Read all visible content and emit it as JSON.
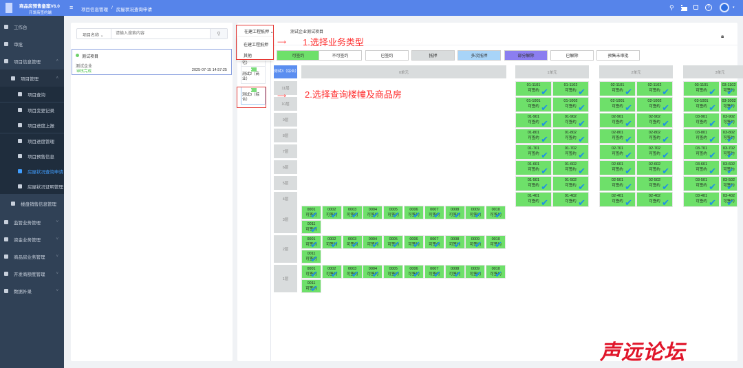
{
  "header": {
    "app_title": "商品房预售备案V6.0",
    "app_subtitle": "开发商签约端",
    "breadcrumb": [
      "项目信息管理",
      "房屋状况查询申请"
    ],
    "separator": "/"
  },
  "sidebar": {
    "items": [
      {
        "label": "工作台",
        "icon": "dashboard-icon"
      },
      {
        "label": "审批",
        "icon": "approval-icon"
      },
      {
        "label": "项目信息管理",
        "icon": "document-icon",
        "chev": "^"
      },
      {
        "label": "项目管理",
        "icon": "grid-icon",
        "chev": "^"
      },
      {
        "label": "项目查询",
        "icon": "search-icon"
      },
      {
        "label": "项目变更记录",
        "icon": "edit-icon"
      },
      {
        "label": "项目进度上报",
        "icon": "upload-icon"
      },
      {
        "label": "项目进度管理",
        "icon": "list-icon"
      },
      {
        "label": "项目预售信息",
        "icon": "table-icon"
      },
      {
        "label": "房屋状况查询申请",
        "icon": "house-icon",
        "active": true
      },
      {
        "label": "房屋状况证明管理",
        "icon": "grid-icon"
      },
      {
        "label": "楼盘销售信息管理",
        "icon": "grid-icon"
      },
      {
        "label": "监管业务管理",
        "icon": "document-icon",
        "chev": "v"
      },
      {
        "label": "资金业务管理",
        "icon": "document-icon",
        "chev": "v"
      },
      {
        "label": "商品房业务管理",
        "icon": "document-icon",
        "chev": "v"
      },
      {
        "label": "开发商额度管理",
        "icon": "document-icon",
        "chev": "v"
      },
      {
        "label": "数据补录",
        "icon": "document-icon",
        "chev": "v"
      }
    ]
  },
  "search": {
    "select": "项目名称",
    "placeholder": "请输入搜索内容"
  },
  "project": {
    "name": "测试项目",
    "company": "测试企业",
    "status": "审核完成",
    "time": "2025-07-15 14:57:25"
  },
  "business_type": {
    "selected": "在建工程抵押",
    "options": [
      "在建工程抵押",
      "其他"
    ],
    "project_title": "测试企业测试项目"
  },
  "buildings": [
    "测试1（住宅）",
    "测试2（商业）",
    "测试3（综合）"
  ],
  "legend": [
    {
      "label": "可签约",
      "bg": "#6ee06a"
    },
    {
      "label": "不可签约",
      "bg": "#fff",
      "corner": "#e020e0"
    },
    {
      "label": "已签约",
      "bg": "#fff",
      "corner": "#30d8b0"
    },
    {
      "label": "抵押",
      "bg": "#d9dcdd"
    },
    {
      "label": "多次抵押",
      "bg": "#a8d4f8"
    },
    {
      "label": "部分解除",
      "bg": "#8b7ef0"
    },
    {
      "label": "已解除",
      "bg": "#fff",
      "corner": "#f0a020"
    },
    {
      "label": "预售未审批",
      "bg": "#fff",
      "corner": "#e02020"
    }
  ],
  "grid": {
    "building_label": "测试3（综合）",
    "floors_upper": [
      "11层",
      "10层",
      "9层",
      "8层",
      "7层",
      "6层",
      "5层",
      "4层"
    ],
    "floors_lower": [
      "3层",
      "2层",
      "1层"
    ],
    "unit0": {
      "label": "0单元",
      "rooms": [
        "0001",
        "0002",
        "0003",
        "0004",
        "0005",
        "0006",
        "0007",
        "0008",
        "0009",
        "0010",
        "0011"
      ]
    },
    "units": [
      {
        "label": "1单元",
        "prefix": "01"
      },
      {
        "label": "2单元",
        "prefix": "02"
      },
      {
        "label": "3单元",
        "prefix": "03"
      }
    ],
    "room_status": "可签约"
  },
  "annotations": [
    "1.选择业务类型",
    "2.选择查询楼幢及商品房"
  ],
  "watermark": "声远论坛"
}
